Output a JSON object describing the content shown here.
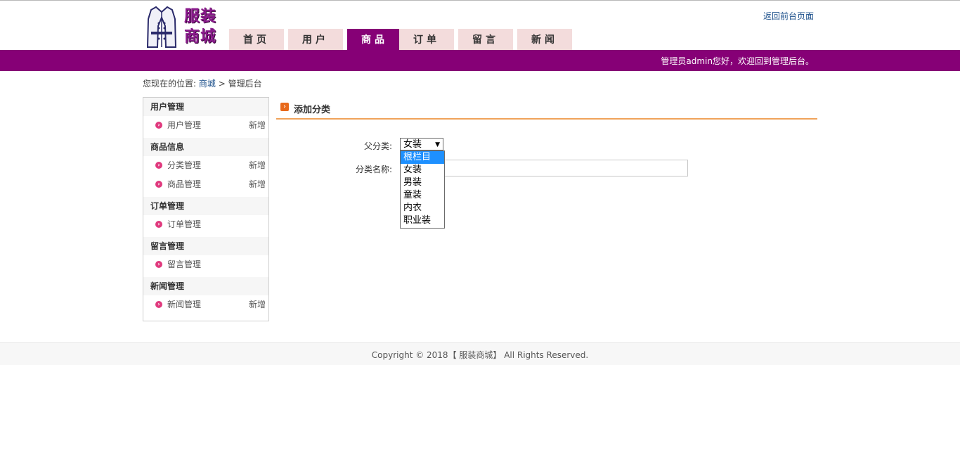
{
  "brand": {
    "logo_text": "服装商城"
  },
  "header": {
    "back_link": "返回前台页面",
    "welcome": "管理员admin您好，欢迎回到管理后台。"
  },
  "nav": [
    {
      "label": "首页"
    },
    {
      "label": "用户"
    },
    {
      "label": "商品",
      "active": true
    },
    {
      "label": "订单"
    },
    {
      "label": "留言"
    },
    {
      "label": "新闻"
    }
  ],
  "breadcrumb": {
    "prefix": "您现在的位置:",
    "link": "商城",
    "sep": ">",
    "current": "管理后台"
  },
  "sidebar": {
    "add_label": "新增",
    "groups": [
      {
        "title": "用户管理",
        "items": [
          {
            "label": "用户管理",
            "add": true
          }
        ]
      },
      {
        "title": "商品信息",
        "items": [
          {
            "label": "分类管理",
            "add": true
          },
          {
            "label": "商品管理",
            "add": true
          }
        ]
      },
      {
        "title": "订单管理",
        "items": [
          {
            "label": "订单管理",
            "add": false
          }
        ]
      },
      {
        "title": "留言管理",
        "items": [
          {
            "label": "留言管理",
            "add": false
          }
        ]
      },
      {
        "title": "新闻管理",
        "items": [
          {
            "label": "新闻管理",
            "add": true
          }
        ]
      }
    ]
  },
  "content": {
    "title": "添加分类",
    "parent_label": "父分类:",
    "parent_value": "女装",
    "parent_options": [
      "根栏目",
      "女装",
      "男装",
      "童装",
      "内衣",
      "职业装"
    ],
    "parent_highlighted": "根栏目",
    "name_label": "分类名称:",
    "name_value": ""
  },
  "footer": {
    "text": "Copyright © 2018【 服装商城】 All Rights Reserved."
  },
  "colors": {
    "primary": "#860076",
    "tab_bg": "#f3dcdc",
    "accent_line": "#f0a35a",
    "bullet": "#e03a7e"
  }
}
